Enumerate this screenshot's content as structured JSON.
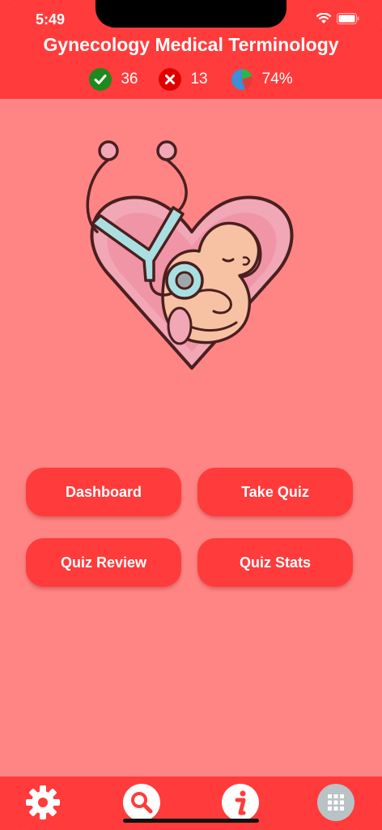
{
  "status_bar": {
    "time": "5:49"
  },
  "header": {
    "title": "Gynecology Medical Terminology",
    "stats": {
      "correct": "36",
      "incorrect": "13",
      "score": "74%"
    }
  },
  "menu": {
    "dashboard": "Dashboard",
    "take_quiz": "Take Quiz",
    "quiz_review": "Quiz Review",
    "quiz_stats": "Quiz Stats"
  },
  "tab_bar": {
    "icons": [
      "gear-icon",
      "search-icon",
      "info-icon",
      "grid-icon"
    ]
  },
  "colors": {
    "primary": "#ff3b3b",
    "background": "#ff8585",
    "correct": "#1d8a1d",
    "incorrect": "#e00000"
  }
}
